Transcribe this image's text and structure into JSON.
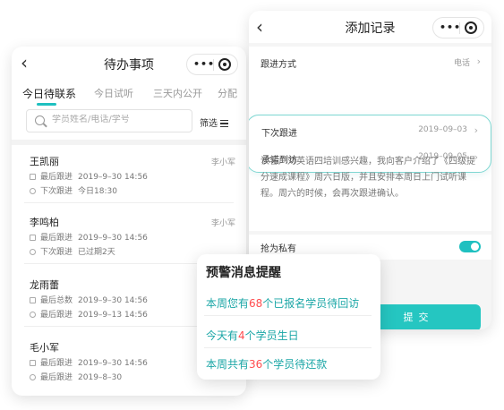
{
  "left_screen": {
    "title": "待办事项",
    "tabs": [
      "今日待联系",
      "今日试听",
      "三天内公开",
      "分配"
    ],
    "search_placeholder": "学员姓名/电话/学号",
    "filter_label": "筛选",
    "contacts": [
      {
        "name": "王凯丽",
        "owner": "李小军",
        "rows": [
          {
            "icon": "doc-icon",
            "label": "最后跟进",
            "value": "2019–9–30 14:56"
          },
          {
            "icon": "clock-icon",
            "label": "下次跟进",
            "value": "今日18:30"
          }
        ]
      },
      {
        "name": "李鸣柏",
        "owner": "李小军",
        "rows": [
          {
            "icon": "doc-icon",
            "label": "最后跟进",
            "value": "2019–9–30 14:56"
          },
          {
            "icon": "clock-icon",
            "label": "下次跟进",
            "value": "已过期2天"
          }
        ]
      },
      {
        "name": "龙雨蕾",
        "owner": "",
        "rows": [
          {
            "icon": "doc-icon",
            "label": "最后总数",
            "value": "2019–9–30 14:56"
          },
          {
            "icon": "clock-icon",
            "label": "最后跟进",
            "value": "2019–9–13 14:56"
          }
        ]
      },
      {
        "name": "毛小军",
        "owner": "",
        "rows": [
          {
            "icon": "doc-icon",
            "label": "最后跟进",
            "value": "2019–9–30 14:56"
          },
          {
            "icon": "clock-icon",
            "label": "最后跟进",
            "value": "2019–8–30"
          }
        ]
      }
    ]
  },
  "right_screen": {
    "title": "添加记录",
    "fields": [
      {
        "label": "跟进方式",
        "value": "电话"
      },
      {
        "label": "下次跟进",
        "value": "2019–09–03"
      },
      {
        "label": "承诺到访",
        "value": "2019–09–05"
      }
    ],
    "note_text": "该客户对英语四培训感兴趣，我向客户介绍了《四级提分速成课程》周六日版，并且安排本周日上门试听课程。周六的时候，会再次跟进确认。",
    "toggle_label": "抢为私有",
    "toggle_on": true,
    "submit_label": "提交"
  },
  "alert": {
    "title": "预警消息提醒",
    "lines": [
      {
        "prefix": "本周您有",
        "num": "68",
        "suffix": "个已报名学员待回访"
      },
      {
        "prefix": "今天有",
        "num": "4",
        "suffix": "个学员生日"
      },
      {
        "prefix": "本周共有",
        "num": "36",
        "suffix": "个学员待还款"
      }
    ]
  },
  "colors": {
    "accent": "#25c6c1",
    "alert_number": "#ff4d4f",
    "alert_text": "#1aa6a6"
  }
}
